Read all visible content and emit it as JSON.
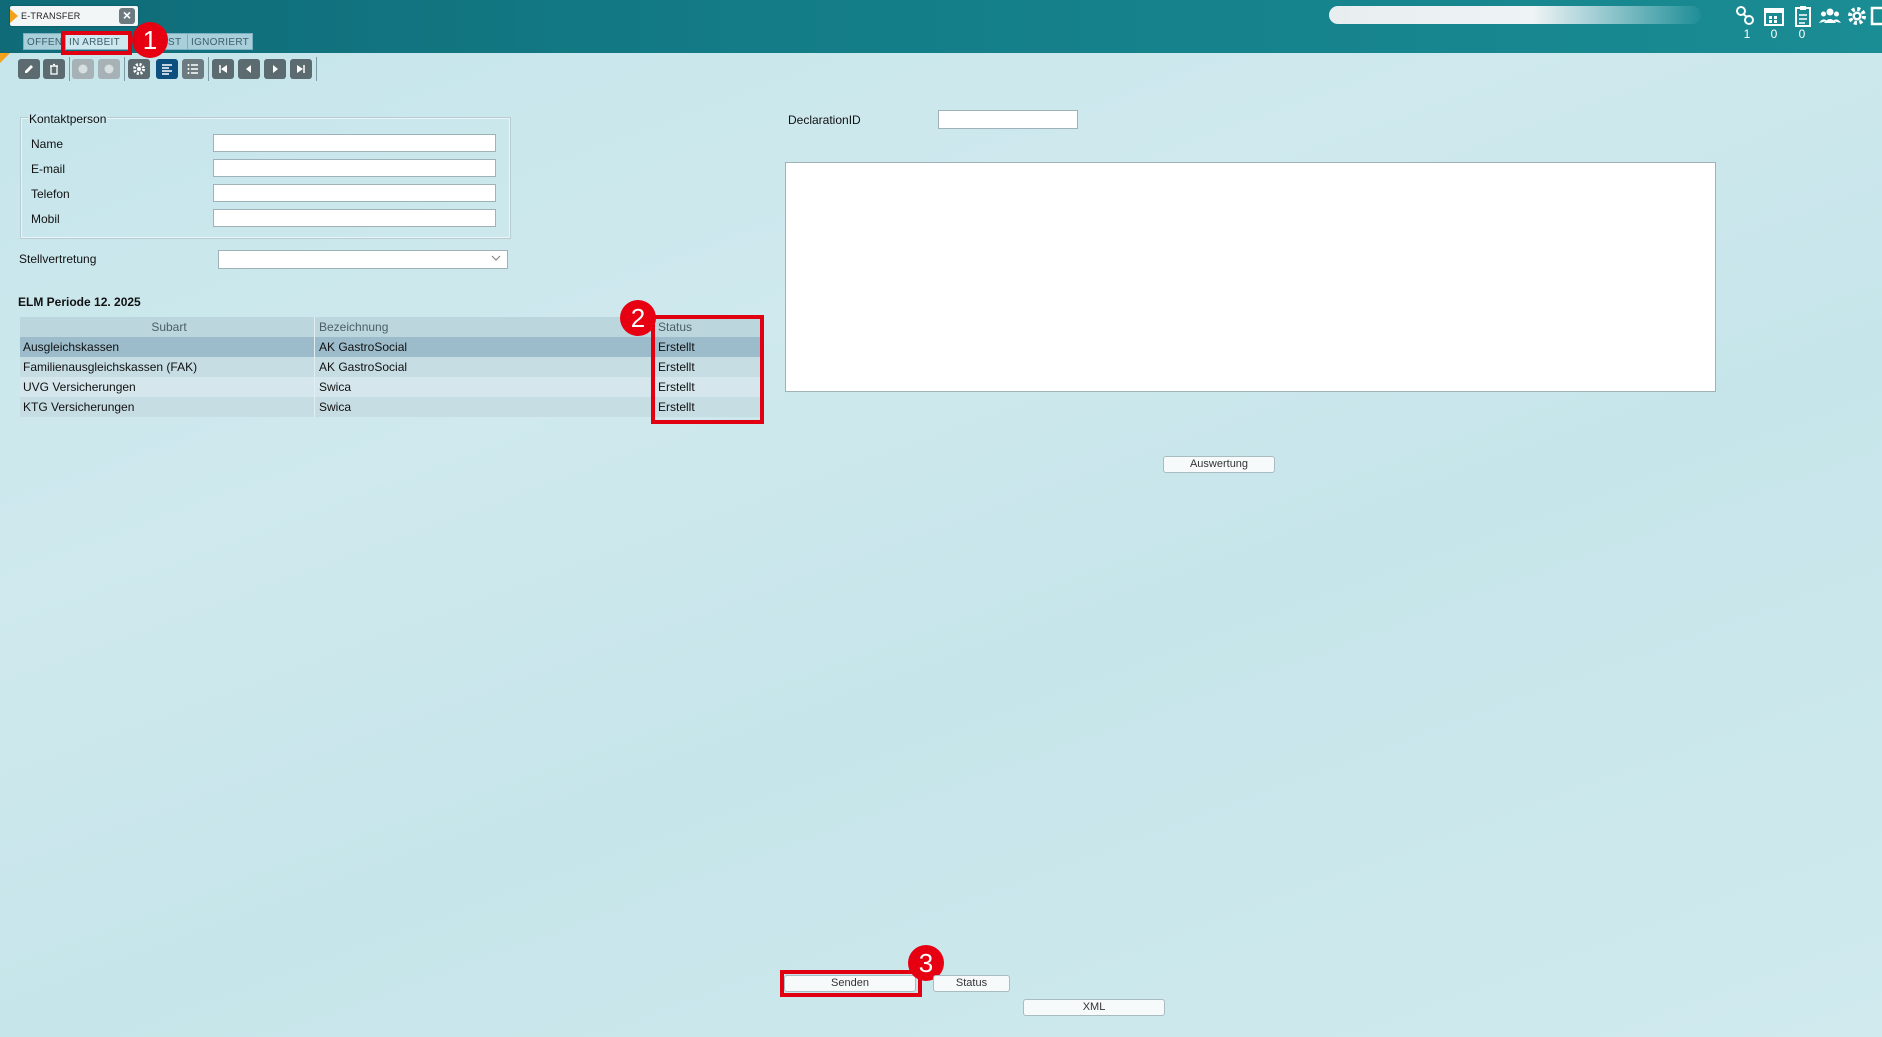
{
  "header": {
    "app_tab_title": "E-TRANSFER",
    "close_symbol": "×",
    "subtabs": [
      "OFFEN",
      "IN ARBEIT",
      "ST",
      "IGNORIERT"
    ],
    "counters": [
      "1",
      "0",
      "0"
    ],
    "icons": [
      "network-icon",
      "calendar-icon",
      "clipboard-icon",
      "users-icon",
      "gear-icon",
      "exit-icon"
    ]
  },
  "toolbar": {
    "icons": [
      "edit-icon",
      "delete-icon",
      "disabled-icon",
      "disabled-icon",
      "settings-icon",
      "detail-view-icon",
      "list-view-icon",
      "first-icon",
      "prev-icon",
      "next-icon",
      "last-icon"
    ]
  },
  "kontakt": {
    "legend": "Kontaktperson",
    "fields": [
      {
        "label": "Name",
        "value": ""
      },
      {
        "label": "E-mail",
        "value": ""
      },
      {
        "label": "Telefon",
        "value": ""
      },
      {
        "label": "Mobil",
        "value": ""
      }
    ]
  },
  "stellvertretung": {
    "label": "Stellvertretung",
    "value": ""
  },
  "period": {
    "title": "ELM Periode 12. 2025"
  },
  "table": {
    "headers": [
      "Subart",
      "Bezeichnung",
      "Status"
    ],
    "rows": [
      [
        "Ausgleichskassen",
        "AK GastroSocial",
        "Erstellt"
      ],
      [
        "Familienausgleichskassen (FAK)",
        "AK GastroSocial",
        "Erstellt"
      ],
      [
        "UVG Versicherungen",
        "Swica",
        "Erstellt"
      ],
      [
        "KTG Versicherungen",
        "Swica",
        "Erstellt"
      ]
    ]
  },
  "right": {
    "declaration_label": "DeclarationID",
    "declaration_value": "",
    "auswertung_button": "Auswertung"
  },
  "footer": {
    "senden": "Senden",
    "status": "Status",
    "xml": "XML"
  },
  "annotations": {
    "badge1": "1",
    "badge2": "2",
    "badge3": "3"
  },
  "colors": {
    "header": "#137c86",
    "accent_red": "#e00011",
    "selected_row": "#9cbccb"
  }
}
